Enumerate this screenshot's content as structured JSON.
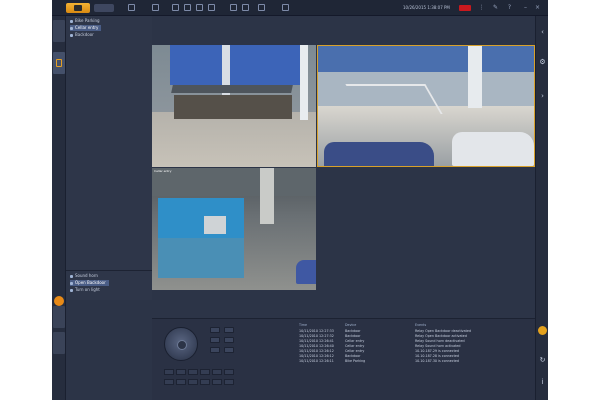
{
  "topbar": {
    "datetime": "10/26/2015 1:38:07 PM"
  },
  "tree": {
    "items": [
      {
        "label": "Bike Parking"
      },
      {
        "label": "Cellar entry"
      },
      {
        "label": "Backdoor"
      }
    ]
  },
  "relays": {
    "items": [
      {
        "label": "Sound horn"
      },
      {
        "label": "Open Backdoor"
      },
      {
        "label": "Turn on light"
      }
    ]
  },
  "events": {
    "headers": {
      "time": "Time",
      "device": "Device",
      "event": "Events"
    },
    "rows": [
      {
        "time": "10/11/2010 12:27:33",
        "device": "Backdoor",
        "event": "Relay Open Backdoor deactivated"
      },
      {
        "time": "10/11/2010 12:27:32",
        "device": "Backdoor",
        "event": "Relay Open Backdoor activated"
      },
      {
        "time": "10/11/2010 12:26:41",
        "device": "Cellar entry",
        "event": "Relay Sound horn deactivated"
      },
      {
        "time": "10/11/2010 12:26:40",
        "device": "Cellar entry",
        "event": "Relay Sound horn activated"
      },
      {
        "time": "10/11/2010 12:26:12",
        "device": "Cellar entry",
        "event": "10.10.187.29 is connected"
      },
      {
        "time": "10/11/2010 12:26:12",
        "device": "Backdoor",
        "event": "10.10.187.28 is connected"
      },
      {
        "time": "10/11/2010 12:26:11",
        "device": "Bike Parking",
        "event": "10.10.187.30 is connected"
      }
    ]
  },
  "cameras": [
    {
      "label": ""
    },
    {
      "label": ""
    },
    {
      "label": "Cellar entry"
    }
  ],
  "colors": {
    "accent": "#e6a023",
    "record": "#c8191e",
    "selection": "#4a5d86"
  }
}
